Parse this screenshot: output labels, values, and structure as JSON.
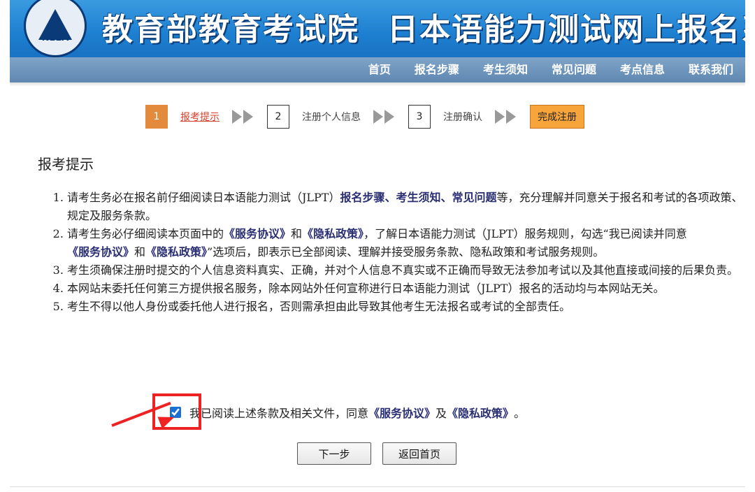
{
  "header": {
    "logo_text": "NEEA",
    "org_title": "教育部教育考试院",
    "system_title": "日本语能力测试网上报名系统"
  },
  "nav": [
    {
      "label": "首页"
    },
    {
      "label": "报名步骤"
    },
    {
      "label": "考生须知"
    },
    {
      "label": "常见问题"
    },
    {
      "label": "考点信息"
    },
    {
      "label": "联系我们"
    }
  ],
  "steps": [
    {
      "num": "1",
      "label": "报考提示"
    },
    {
      "num": "2",
      "label": "注册个人信息"
    },
    {
      "num": "3",
      "label": "注册确认"
    }
  ],
  "finish_label": "完成注册",
  "section_title": "报考提示",
  "notes": {
    "n1a": "请考生务必在报名前仔细阅读日本语能力测试（JLPT）",
    "n1b": "报名步骤、考生须知、常见问题",
    "n1c": "等，充分理解并同意关于报名和考试的各项政策、规定及服务条款。",
    "n2a": "请考生务必仔细阅读本页面中的",
    "n2b": "《服务协议》",
    "n2c": "和",
    "n2d": "《隐私政策》",
    "n2e": "，了解日本语能力测试（JLPT）服务规则，勾选“我已阅读并同意",
    "n2f": "《服务协议》",
    "n2g": "和",
    "n2h": "《隐私政策》",
    "n2i": "”选项后，即表示已全部阅读、理解并接受服务条款、隐私政策和考试服务规则。",
    "n3": "考生须确保注册时提交的个人信息资料真实、正确，并对个人信息不真实或不正确而导致无法参加考试以及其他直接或间接的后果负责。",
    "n4": "本网站未委托任何第三方提供报名服务，除本网站外任何宣称进行日本语能力测试（JLPT）报名的活动均与本网站无关。",
    "n5": "考生不得以他人身份或委托他人进行报名，否则需承担由此导致其他考生无法报名或考试的全部责任。"
  },
  "agree": {
    "checked": true,
    "text_a": "我已阅读上述条款及相关文件，同意",
    "link1": "《服务协议》",
    "text_b": "及",
    "link2": "《隐私政策》",
    "text_c": "。"
  },
  "buttons": {
    "next": "下一步",
    "home": "返回首页"
  },
  "colors": {
    "banner": "#1d7fd0",
    "navbar": "#6a90b8",
    "active_step": "#e38a3c",
    "finish": "#f7a53a",
    "annotation": "#ee2222"
  }
}
